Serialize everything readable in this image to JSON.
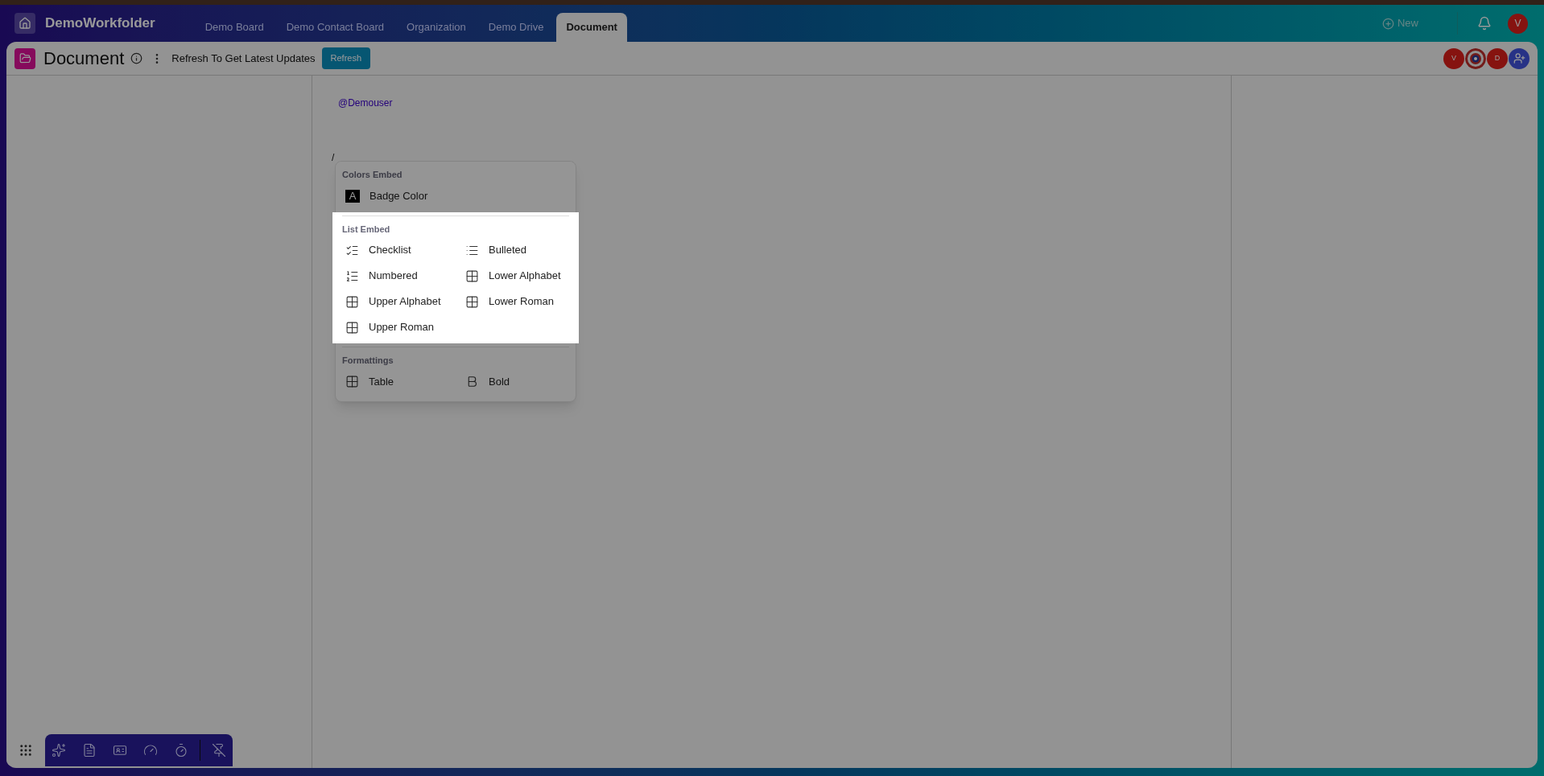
{
  "app": {
    "title": "DemoWorkfolder"
  },
  "tabs": [
    {
      "label": "Demo Board",
      "selected": false
    },
    {
      "label": "Demo Contact Board",
      "selected": false
    },
    {
      "label": "Organization",
      "selected": false
    },
    {
      "label": "Demo Drive",
      "selected": false
    },
    {
      "label": "Document",
      "selected": true
    }
  ],
  "top_actions": {
    "new_label": "New",
    "user_initial": "V"
  },
  "header": {
    "title": "Document",
    "notice": "Refresh To Get Latest Updates",
    "refresh_label": "Refresh"
  },
  "collaborators": [
    {
      "kind": "initial",
      "initial": "V"
    },
    {
      "kind": "picture"
    },
    {
      "kind": "initial",
      "initial": "D"
    },
    {
      "kind": "add"
    }
  ],
  "editor": {
    "mention": "@Demouser",
    "slash": "/"
  },
  "menu": {
    "sections": [
      {
        "title": "Colors Embed",
        "highlighted": false,
        "items": [
          {
            "kind": "badge",
            "glyph": "A",
            "label": "Badge Color"
          }
        ]
      },
      {
        "title": "List Embed",
        "highlighted": true,
        "items": [
          {
            "kind": "checklist",
            "label": "Checklist"
          },
          {
            "kind": "bulleted",
            "label": "Bulleted"
          },
          {
            "kind": "numbered",
            "label": "Numbered"
          },
          {
            "kind": "table",
            "label": "Lower Alphabet"
          },
          {
            "kind": "table",
            "label": "Upper Alphabet"
          },
          {
            "kind": "table",
            "label": "Lower Roman"
          },
          {
            "kind": "table",
            "label": "Upper Roman"
          }
        ]
      },
      {
        "title": "Formattings",
        "highlighted": false,
        "items": [
          {
            "kind": "table",
            "label": "Table"
          },
          {
            "kind": "bold",
            "label": "Bold"
          }
        ]
      }
    ]
  },
  "dock": [
    {
      "kind": "sparkles"
    },
    {
      "kind": "document"
    },
    {
      "kind": "card"
    },
    {
      "kind": "gauge"
    },
    {
      "kind": "timer"
    },
    {
      "kind": "pin-off"
    }
  ]
}
